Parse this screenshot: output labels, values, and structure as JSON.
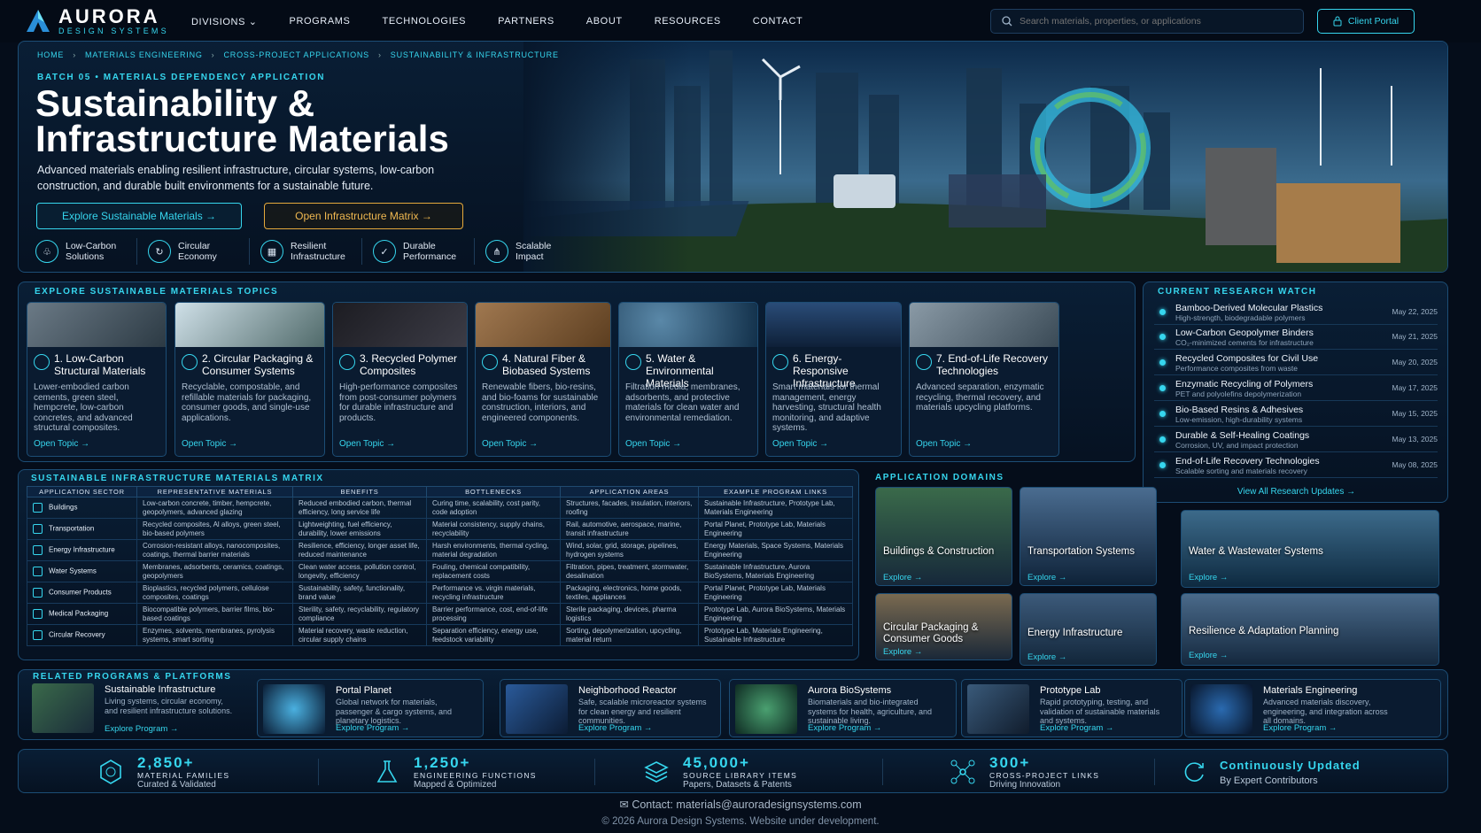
{
  "brand": {
    "name": "AURORA",
    "tagline": "DESIGN SYSTEMS"
  },
  "nav": [
    "DIVISIONS",
    "PROGRAMS",
    "TECHNOLOGIES",
    "PARTNERS",
    "ABOUT",
    "RESOURCES",
    "CONTACT"
  ],
  "search": {
    "placeholder": "Search materials, properties, or applications"
  },
  "portal_label": "Client Portal",
  "breadcrumb": [
    "HOME",
    "MATERIALS ENGINEERING",
    "CROSS-PROJECT APPLICATIONS",
    "SUSTAINABILITY & INFRASTRUCTURE"
  ],
  "hero": {
    "eyebrow": "BATCH 05 • MATERIALS DEPENDENCY APPLICATION",
    "title": "Sustainability & Infrastructure Materials",
    "lead": "Advanced materials enabling resilient infrastructure, circular systems, low-carbon construction, and durable built environments for a sustainable future.",
    "btn_primary": "Explore Sustainable Materials →",
    "btn_secondary": "Open Infrastructure Matrix →",
    "features": [
      {
        "label": "Low-Carbon Solutions",
        "icon": "leaf-shield-icon"
      },
      {
        "label": "Circular Economy",
        "icon": "recycle-icon"
      },
      {
        "label": "Resilient Infrastructure",
        "icon": "building-icon"
      },
      {
        "label": "Durable Performance",
        "icon": "shield-check-icon"
      },
      {
        "label": "Scalable Impact",
        "icon": "network-icon"
      }
    ]
  },
  "topics": {
    "title": "EXPLORE SUSTAINABLE MATERIALS TOPICS",
    "link_label": "Open Topic →",
    "items": [
      {
        "title": "1. Low-Carbon Structural Materials",
        "desc": "Lower-embodied carbon cements, green steel, hempcrete, low-carbon concretes, and advanced structural composites."
      },
      {
        "title": "2. Circular Packaging & Consumer Systems",
        "desc": "Recyclable, compostable, and refillable materials for packaging, consumer goods, and single-use applications."
      },
      {
        "title": "3. Recycled Polymer Composites",
        "desc": "High-performance composites from post-consumer polymers for durable infrastructure and products."
      },
      {
        "title": "4. Natural Fiber & Biobased Systems",
        "desc": "Renewable fibers, bio-resins, and bio-foams for sustainable construction, interiors, and engineered components."
      },
      {
        "title": "5. Water & Environmental Materials",
        "desc": "Filtration media, membranes, adsorbents, and protective materials for clean water and environmental remediation."
      },
      {
        "title": "6. Energy-Responsive Infrastructure",
        "desc": "Smart materials for thermal management, energy harvesting, structural health monitoring, and adaptive systems."
      },
      {
        "title": "7. End-of-Life Recovery Technologies",
        "desc": "Advanced separation, enzymatic recycling, thermal recovery, and materials upcycling platforms."
      }
    ]
  },
  "research": {
    "title": "CURRENT RESEARCH WATCH",
    "view_all": "View All Research Updates →",
    "items": [
      {
        "title": "Bamboo-Derived Molecular Plastics",
        "sub": "High-strength, biodegradable polymers",
        "date": "May 22, 2025"
      },
      {
        "title": "Low-Carbon Geopolymer Binders",
        "sub": "CO₂-minimized cements for infrastructure",
        "date": "May 21, 2025"
      },
      {
        "title": "Recycled Composites for Civil Use",
        "sub": "Performance composites from waste",
        "date": "May 20, 2025"
      },
      {
        "title": "Enzymatic Recycling of Polymers",
        "sub": "PET and polyolefins depolymerization",
        "date": "May 17, 2025"
      },
      {
        "title": "Bio-Based Resins & Adhesives",
        "sub": "Low-emission, high-durability systems",
        "date": "May 15, 2025"
      },
      {
        "title": "Durable & Self-Healing Coatings",
        "sub": "Corrosion, UV, and impact protection",
        "date": "May 13, 2025"
      },
      {
        "title": "End-of-Life Recovery Technologies",
        "sub": "Scalable sorting and materials recovery",
        "date": "May 08, 2025"
      }
    ]
  },
  "matrix": {
    "title": "SUSTAINABLE INFRASTRUCTURE MATERIALS MATRIX",
    "columns": [
      "APPLICATION SECTOR",
      "REPRESENTATIVE MATERIALS",
      "BENEFITS",
      "BOTTLENECKS",
      "APPLICATION AREAS",
      "EXAMPLE PROGRAM LINKS"
    ],
    "rows": [
      [
        "Buildings",
        "Low-carbon concrete, timber, hempcrete, geopolymers, advanced glazing",
        "Reduced embodied carbon, thermal efficiency, long service life",
        "Curing time, scalability, cost parity, code adoption",
        "Structures, facades, insulation, interiors, roofing",
        "Sustainable Infrastructure, Prototype Lab, Materials Engineering"
      ],
      [
        "Transportation",
        "Recycled composites, Al alloys, green steel, bio-based polymers",
        "Lightweighting, fuel efficiency, durability, lower emissions",
        "Material consistency, supply chains, recyclability",
        "Rail, automotive, aerospace, marine, transit infrastructure",
        "Portal Planet, Prototype Lab, Materials Engineering"
      ],
      [
        "Energy Infrastructure",
        "Corrosion-resistant alloys, nanocomposites, coatings, thermal barrier materials",
        "Resilience, efficiency, longer asset life, reduced maintenance",
        "Harsh environments, thermal cycling, material degradation",
        "Wind, solar, grid, storage, pipelines, hydrogen systems",
        "Energy Materials, Space Systems, Materials Engineering"
      ],
      [
        "Water Systems",
        "Membranes, adsorbents, ceramics, coatings, geopolymers",
        "Clean water access, pollution control, longevity, efficiency",
        "Fouling, chemical compatibility, replacement costs",
        "Filtration, pipes, treatment, stormwater, desalination",
        "Sustainable Infrastructure, Aurora BioSystems, Materials Engineering"
      ],
      [
        "Consumer Products",
        "Bioplastics, recycled polymers, cellulose composites, coatings",
        "Sustainability, safety, functionality, brand value",
        "Performance vs. virgin materials, recycling infrastructure",
        "Packaging, electronics, home goods, textiles, appliances",
        "Portal Planet, Prototype Lab, Materials Engineering"
      ],
      [
        "Medical Packaging",
        "Biocompatible polymers, barrier films, bio-based coatings",
        "Sterility, safety, recyclability, regulatory compliance",
        "Barrier performance, cost, end-of-life processing",
        "Sterile packaging, devices, pharma logistics",
        "Prototype Lab, Aurora BioSystems, Materials Engineering"
      ],
      [
        "Circular Recovery",
        "Enzymes, solvents, membranes, pyrolysis systems, smart sorting",
        "Material recovery, waste reduction, circular supply chains",
        "Separation efficiency, energy use, feedstock variability",
        "Sorting, depolymerization, upcycling, material return",
        "Prototype Lab, Materials Engineering, Sustainable Infrastructure"
      ]
    ]
  },
  "domains": {
    "title": "APPLICATION DOMAINS",
    "link_label": "Explore →",
    "items": [
      "Buildings & Construction",
      "Transportation Systems",
      "Water & Wastewater Systems",
      "Circular Packaging & Consumer Goods",
      "Energy Infrastructure",
      "Resilience & Adaptation Planning"
    ]
  },
  "programs": {
    "title": "RELATED PROGRAMS & PLATFORMS",
    "link_label": "Explore Program →",
    "items": [
      {
        "title": "Sustainable Infrastructure",
        "desc": "Living systems, circular economy, and resilient infrastructure solutions."
      },
      {
        "title": "Portal Planet",
        "desc": "Global network for materials, passenger & cargo systems, and planetary logistics."
      },
      {
        "title": "Neighborhood Reactor",
        "desc": "Safe, scalable microreactor systems for clean energy and resilient communities."
      },
      {
        "title": "Aurora BioSystems",
        "desc": "Biomaterials and bio-integrated systems for health, agriculture, and sustainable living."
      },
      {
        "title": "Prototype Lab",
        "desc": "Rapid prototyping, testing, and validation of sustainable materials and systems."
      },
      {
        "title": "Materials Engineering",
        "desc": "Advanced materials discovery, engineering, and integration across all domains."
      }
    ]
  },
  "stats": [
    {
      "value": "2,850+",
      "label": "MATERIAL FAMILIES",
      "sub": "Curated & Validated"
    },
    {
      "value": "1,250+",
      "label": "ENGINEERING FUNCTIONS",
      "sub": "Mapped & Optimized"
    },
    {
      "value": "45,000+",
      "label": "SOURCE LIBRARY ITEMS",
      "sub": "Papers, Datasets & Patents"
    },
    {
      "value": "300+",
      "label": "CROSS-PROJECT LINKS",
      "sub": "Driving Innovation"
    },
    {
      "value": "Continuously Updated",
      "label": "",
      "sub": "By Expert Contributors"
    }
  ],
  "footer": {
    "contact": "Contact: materials@auroradesignsystems.com",
    "copyright": "© 2026 Aurora Design Systems. Website under development."
  },
  "colors": {
    "accent": "#36d6ee",
    "gold": "#e5a93c",
    "background": "#050d1a"
  }
}
